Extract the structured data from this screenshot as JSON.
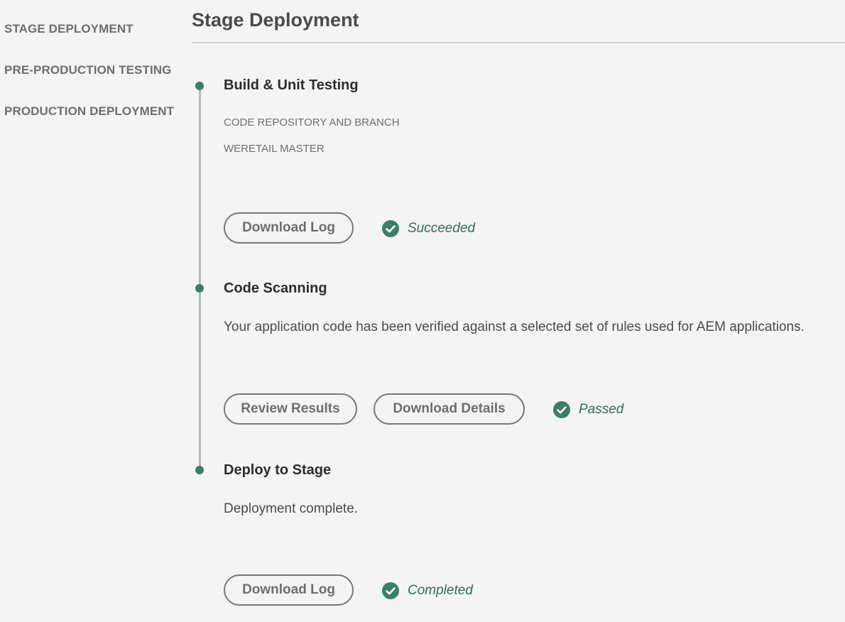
{
  "sidebar": {
    "items": [
      {
        "label": "STAGE DEPLOYMENT"
      },
      {
        "label": "PRE-PRODUCTION TESTING"
      },
      {
        "label": "PRODUCTION DEPLOYMENT"
      }
    ]
  },
  "header": {
    "title": "Stage Deployment"
  },
  "steps": [
    {
      "title": "Build & Unit Testing",
      "meta_label": "CODE REPOSITORY AND BRANCH",
      "meta_value": "WERETAIL MASTER",
      "buttons": [
        {
          "label": "Download Log"
        }
      ],
      "status": {
        "label": "Succeeded",
        "icon": "check-circle-icon"
      }
    },
    {
      "title": "Code Scanning",
      "description": "Your application code has been verified against a selected set of rules used for AEM applications.",
      "buttons": [
        {
          "label": "Review Results"
        },
        {
          "label": "Download Details"
        }
      ],
      "status": {
        "label": "Passed",
        "icon": "check-circle-icon"
      }
    },
    {
      "title": "Deploy to Stage",
      "description": "Deployment complete.",
      "buttons": [
        {
          "label": "Download Log"
        }
      ],
      "status": {
        "label": "Completed",
        "icon": "check-circle-icon"
      }
    }
  ],
  "colors": {
    "accent": "#3a7f66",
    "status_text": "#2f6e57",
    "background": "#f4f4f4"
  }
}
